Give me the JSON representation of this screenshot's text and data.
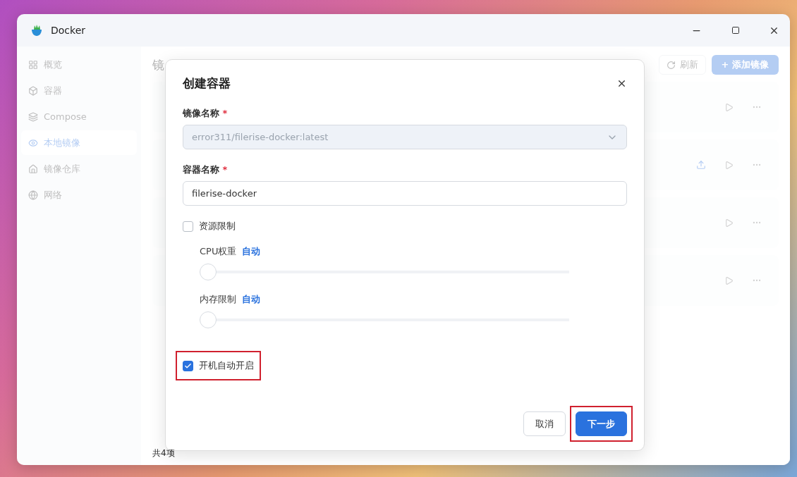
{
  "window": {
    "title": "Docker"
  },
  "sidebar": {
    "items": [
      {
        "label": "概览",
        "selected": false
      },
      {
        "label": "容器",
        "selected": false
      },
      {
        "label": "Compose",
        "selected": false
      },
      {
        "label": "本地镜像",
        "selected": true
      },
      {
        "label": "镜像仓库",
        "selected": false
      },
      {
        "label": "网络",
        "selected": false
      }
    ]
  },
  "page": {
    "title": "镜",
    "toolbar": {
      "refresh": "刷新",
      "add": "+ 添加镜像"
    },
    "rows": [
      {
        "upload": false
      },
      {
        "upload": true
      },
      {
        "upload": false
      },
      {
        "upload": false
      }
    ],
    "footer": "共4项"
  },
  "dialog": {
    "title": "创建容器",
    "image_field": {
      "label": "镜像名称",
      "required_mark": "*",
      "value": "error311/filerise-docker:latest",
      "disabled": true
    },
    "name_field": {
      "label": "容器名称",
      "required_mark": "*",
      "value": "filerise-docker"
    },
    "resource_limit": {
      "label": "资源限制",
      "checked": false
    },
    "sliders": [
      {
        "label": "CPU权重",
        "value": "自动",
        "level": 0
      },
      {
        "label": "内存限制",
        "value": "自动",
        "level": 0
      }
    ],
    "autostart": {
      "label": "开机自动开启",
      "checked": true,
      "highlighted": true
    },
    "buttons": [
      {
        "label": "取消",
        "kind": "secondary",
        "highlighted": false
      },
      {
        "label": "下一步",
        "kind": "primary",
        "highlighted": true
      }
    ]
  }
}
